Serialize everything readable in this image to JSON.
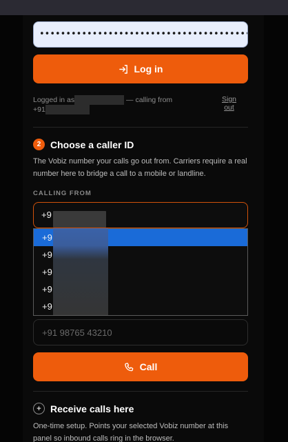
{
  "login": {
    "password_value": "••••••••••••••••••••••••••••••••••••••••••••••••••••••••",
    "button_label": "Log in",
    "status_prefix": "Logged in as",
    "status_mid": " — calling from",
    "status_line2": "+91",
    "signout_line1": "Sign",
    "signout_line2": "out"
  },
  "caller_id": {
    "step_number": "2",
    "title": "Choose a caller ID",
    "description": "The Vobiz number your calls go out from. Carriers require a real number here to bridge a call to a mobile or landline.",
    "field_label": "CALLING FROM",
    "selected_value": "+9",
    "options": [
      "+9",
      "+9",
      "+9",
      "+9",
      "+9"
    ]
  },
  "dial": {
    "placeholder": "+91 98765 43210",
    "call_label": "Call"
  },
  "receive": {
    "title": "Receive calls here",
    "description": "One-time setup. Points your selected Vobiz number at this panel so inbound calls ring in the browser."
  },
  "colors": {
    "accent": "#ee5c0c",
    "selected_option": "#1a6bd8",
    "background": "#0a0a0a"
  }
}
